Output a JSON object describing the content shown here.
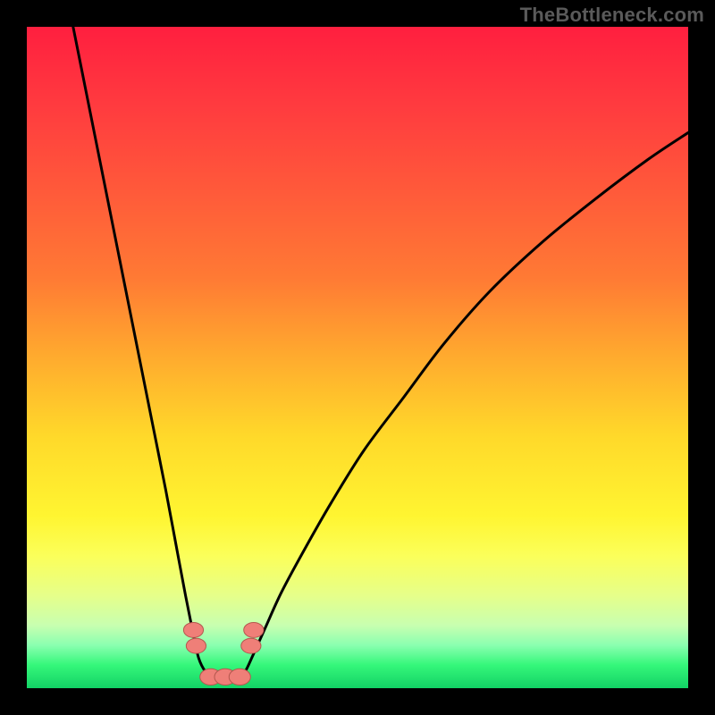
{
  "watermark": "TheBottleneck.com",
  "colors": {
    "background": "#000000",
    "curve_stroke": "#000000",
    "marker_fill": "#ef7f78",
    "marker_stroke": "#b5584f",
    "gradient_stops": [
      {
        "offset": 0.0,
        "color": "#ff1f3f"
      },
      {
        "offset": 0.12,
        "color": "#ff3b3f"
      },
      {
        "offset": 0.25,
        "color": "#ff5a3a"
      },
      {
        "offset": 0.38,
        "color": "#ff7a34"
      },
      {
        "offset": 0.5,
        "color": "#ffab2e"
      },
      {
        "offset": 0.62,
        "color": "#ffd92a"
      },
      {
        "offset": 0.74,
        "color": "#fff531"
      },
      {
        "offset": 0.8,
        "color": "#fbff5a"
      },
      {
        "offset": 0.86,
        "color": "#e6ff8a"
      },
      {
        "offset": 0.905,
        "color": "#c8ffb0"
      },
      {
        "offset": 0.935,
        "color": "#8affb0"
      },
      {
        "offset": 0.965,
        "color": "#35f77a"
      },
      {
        "offset": 1.0,
        "color": "#12d265"
      }
    ]
  },
  "chart_data": {
    "type": "line",
    "title": "",
    "xlabel": "",
    "ylabel": "",
    "xlim": [
      0,
      100
    ],
    "ylim": [
      0,
      100
    ],
    "grid": false,
    "series": [
      {
        "name": "left-arm",
        "values_xy": [
          [
            7,
            100
          ],
          [
            9,
            90
          ],
          [
            11,
            80
          ],
          [
            13,
            70
          ],
          [
            15,
            60
          ],
          [
            17,
            50
          ],
          [
            19,
            40
          ],
          [
            21,
            30
          ],
          [
            22.5,
            22
          ],
          [
            24,
            14
          ],
          [
            25.2,
            8
          ],
          [
            26,
            4.5
          ],
          [
            27,
            2.5
          ],
          [
            28,
            1.7
          ]
        ]
      },
      {
        "name": "right-arm",
        "values_xy": [
          [
            32,
            1.7
          ],
          [
            33,
            2.5
          ],
          [
            34.2,
            5
          ],
          [
            36,
            9
          ],
          [
            38.5,
            14.5
          ],
          [
            42,
            21
          ],
          [
            46,
            28
          ],
          [
            51,
            36
          ],
          [
            57,
            44
          ],
          [
            63,
            52
          ],
          [
            70,
            60
          ],
          [
            78,
            67.5
          ],
          [
            86,
            74
          ],
          [
            94,
            80
          ],
          [
            100,
            84
          ]
        ]
      },
      {
        "name": "floor",
        "values_xy": [
          [
            28,
            1.7
          ],
          [
            32,
            1.7
          ]
        ]
      }
    ],
    "markers": [
      {
        "name": "left-dot-upper",
        "x": 25.2,
        "y": 8.8,
        "r": 1.2
      },
      {
        "name": "left-dot-lower",
        "x": 25.6,
        "y": 6.4,
        "r": 1.2
      },
      {
        "name": "right-dot-upper",
        "x": 34.3,
        "y": 8.8,
        "r": 1.2
      },
      {
        "name": "right-dot-lower",
        "x": 33.9,
        "y": 6.4,
        "r": 1.2
      },
      {
        "name": "floor-dot-left",
        "x": 27.8,
        "y": 1.7,
        "r": 1.3
      },
      {
        "name": "floor-dot-mid",
        "x": 30.0,
        "y": 1.7,
        "r": 1.3
      },
      {
        "name": "floor-dot-right",
        "x": 32.2,
        "y": 1.7,
        "r": 1.3
      }
    ]
  }
}
